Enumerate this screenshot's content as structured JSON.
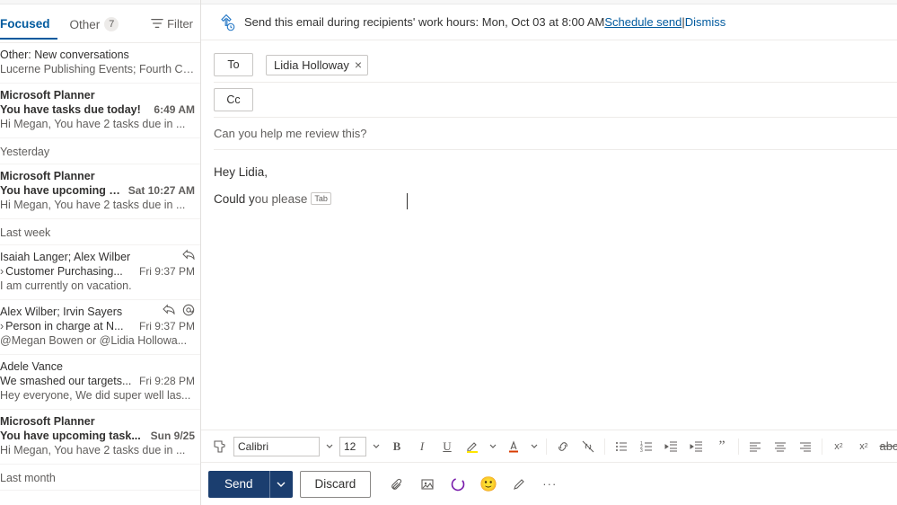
{
  "tabs": {
    "focused": "Focused",
    "other": "Other",
    "other_count": "7",
    "filter": "Filter"
  },
  "list": {
    "top": {
      "sender": "Other: New conversations",
      "subject": "Lucerne Publishing Events; Fourth Coffe..."
    },
    "item1": {
      "sender": "Microsoft Planner",
      "subject": "You have tasks due today!",
      "time": "6:49 AM",
      "preview": "Hi Megan, You have 2 tasks due in ..."
    },
    "hdr_yesterday": "Yesterday",
    "item2": {
      "sender": "Microsoft Planner",
      "subject": "You have upcoming t...",
      "time": "Sat 10:27 AM",
      "preview": "Hi Megan, You have 2 tasks due in ..."
    },
    "hdr_lastweek": "Last week",
    "item3": {
      "sender": "Isaiah Langer; Alex Wilber",
      "subject": "Customer Purchasing...",
      "time": "Fri 9:37 PM",
      "preview": "I am currently on vacation."
    },
    "item4": {
      "sender": "Alex Wilber; Irvin Sayers",
      "subject": "Person in charge at N...",
      "time": "Fri 9:37 PM",
      "preview": "@Megan Bowen or @Lidia Hollowa..."
    },
    "item5": {
      "sender": "Adele Vance",
      "subject": "We smashed our targets...",
      "time": "Fri 9:28 PM",
      "preview": "Hey everyone, We did super well las..."
    },
    "item6": {
      "sender": "Microsoft Planner",
      "subject": "You have upcoming task...",
      "time": "Sun 9/25",
      "preview": "Hi Megan, You have 2 tasks due in ..."
    },
    "hdr_lastmonth": "Last month"
  },
  "infobar": {
    "text1": "Send this email during recipients' work hours: Mon, Oct 03 at 8:00 AM ",
    "link1": "Schedule send",
    "sep": " | ",
    "link2": "Dismiss"
  },
  "compose": {
    "to_label": "To",
    "cc_label": "Cc",
    "recipient": "Lidia Holloway",
    "subject": "Can you help me review this?",
    "greeting": "Hey Lidia,",
    "body_before": "Could y",
    "body_after": "ou please",
    "tab_hint": "Tab"
  },
  "fmt": {
    "font": "Calibri",
    "size": "12"
  },
  "actions": {
    "send": "Send",
    "discard": "Discard"
  }
}
